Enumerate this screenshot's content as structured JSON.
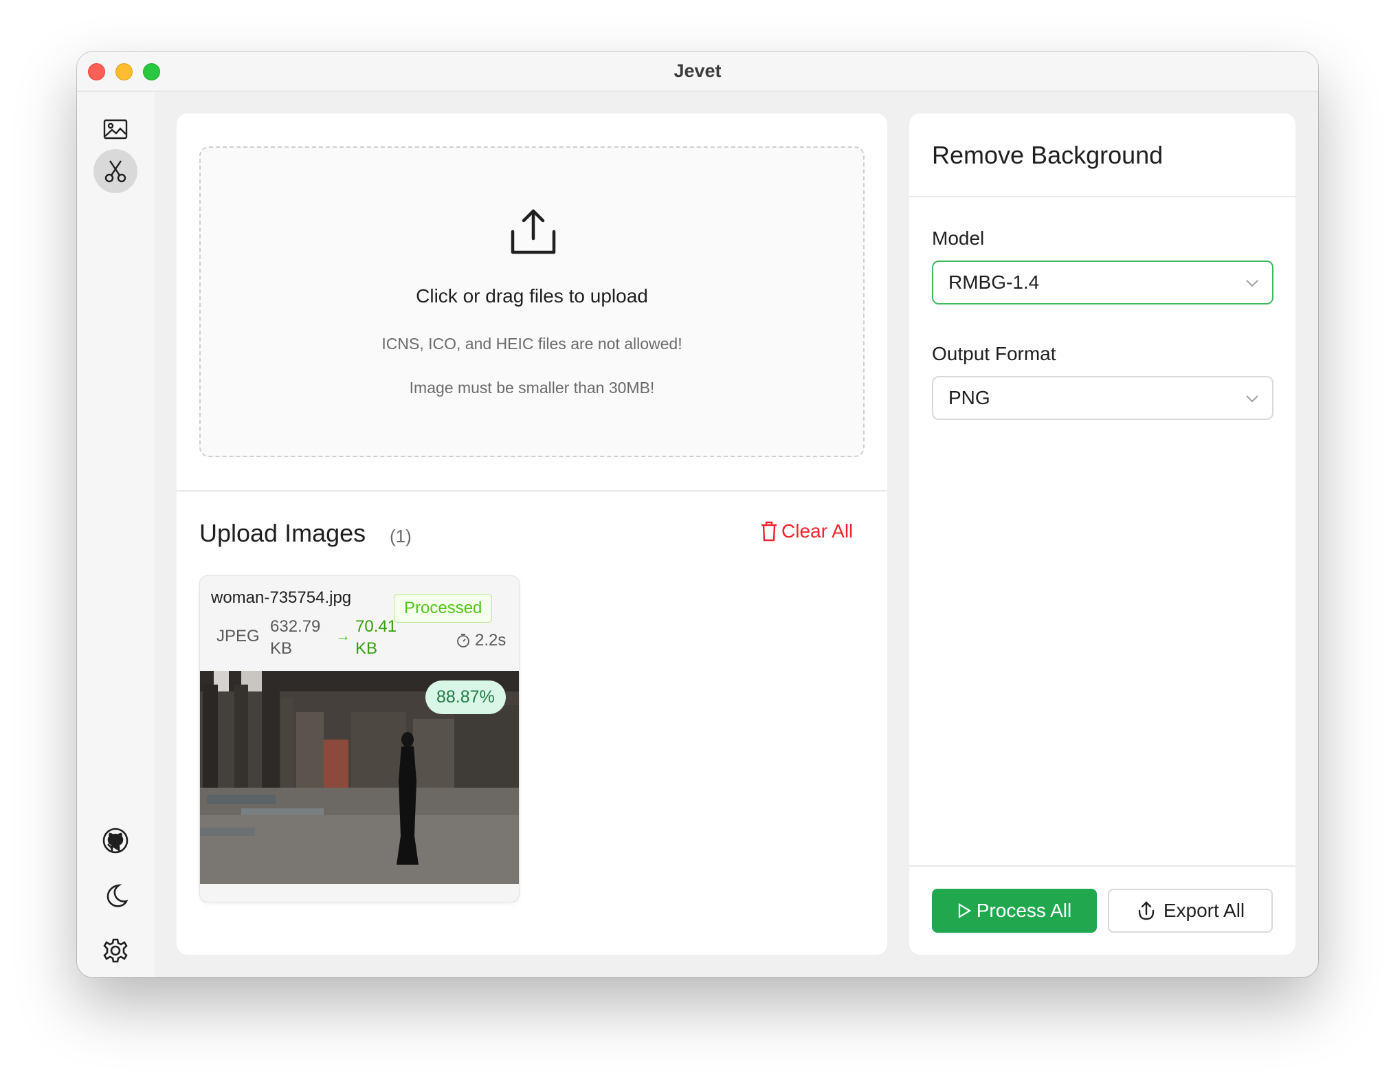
{
  "window": {
    "title": "Jevet"
  },
  "sidebar": {
    "top_items": [
      {
        "icon": "image-icon",
        "active": false
      },
      {
        "icon": "scissors-icon",
        "active": true
      }
    ],
    "bottom_items": [
      {
        "icon": "github-icon"
      },
      {
        "icon": "moon-icon"
      },
      {
        "icon": "gear-icon"
      }
    ]
  },
  "upload": {
    "main_text": "Click or drag files to upload",
    "note_formats": "ICNS, ICO, and HEIC files are not allowed!",
    "note_size": "Image must be smaller than 30MB!"
  },
  "images_section": {
    "title": "Upload Images",
    "count": "(1)",
    "clear_all_label": "Clear All"
  },
  "image_card": {
    "filename": "woman-735754.jpg",
    "status": "Processed",
    "format": "JPEG",
    "original_size_value": "632.79",
    "original_size_unit": "KB",
    "arrow": "→",
    "processed_size_value": "70.41",
    "processed_size_unit": "KB",
    "duration": "2.2s",
    "reduction": "88.87%"
  },
  "settings": {
    "title": "Remove Background",
    "model_label": "Model",
    "model_value": "RMBG-1.4",
    "format_label": "Output Format",
    "format_value": "PNG",
    "process_all_label": "Process All",
    "export_all_label": "Export All"
  },
  "colors": {
    "accent_green": "#21a84f",
    "danger_red": "#f5222d",
    "processed_green": "#52c41a"
  }
}
